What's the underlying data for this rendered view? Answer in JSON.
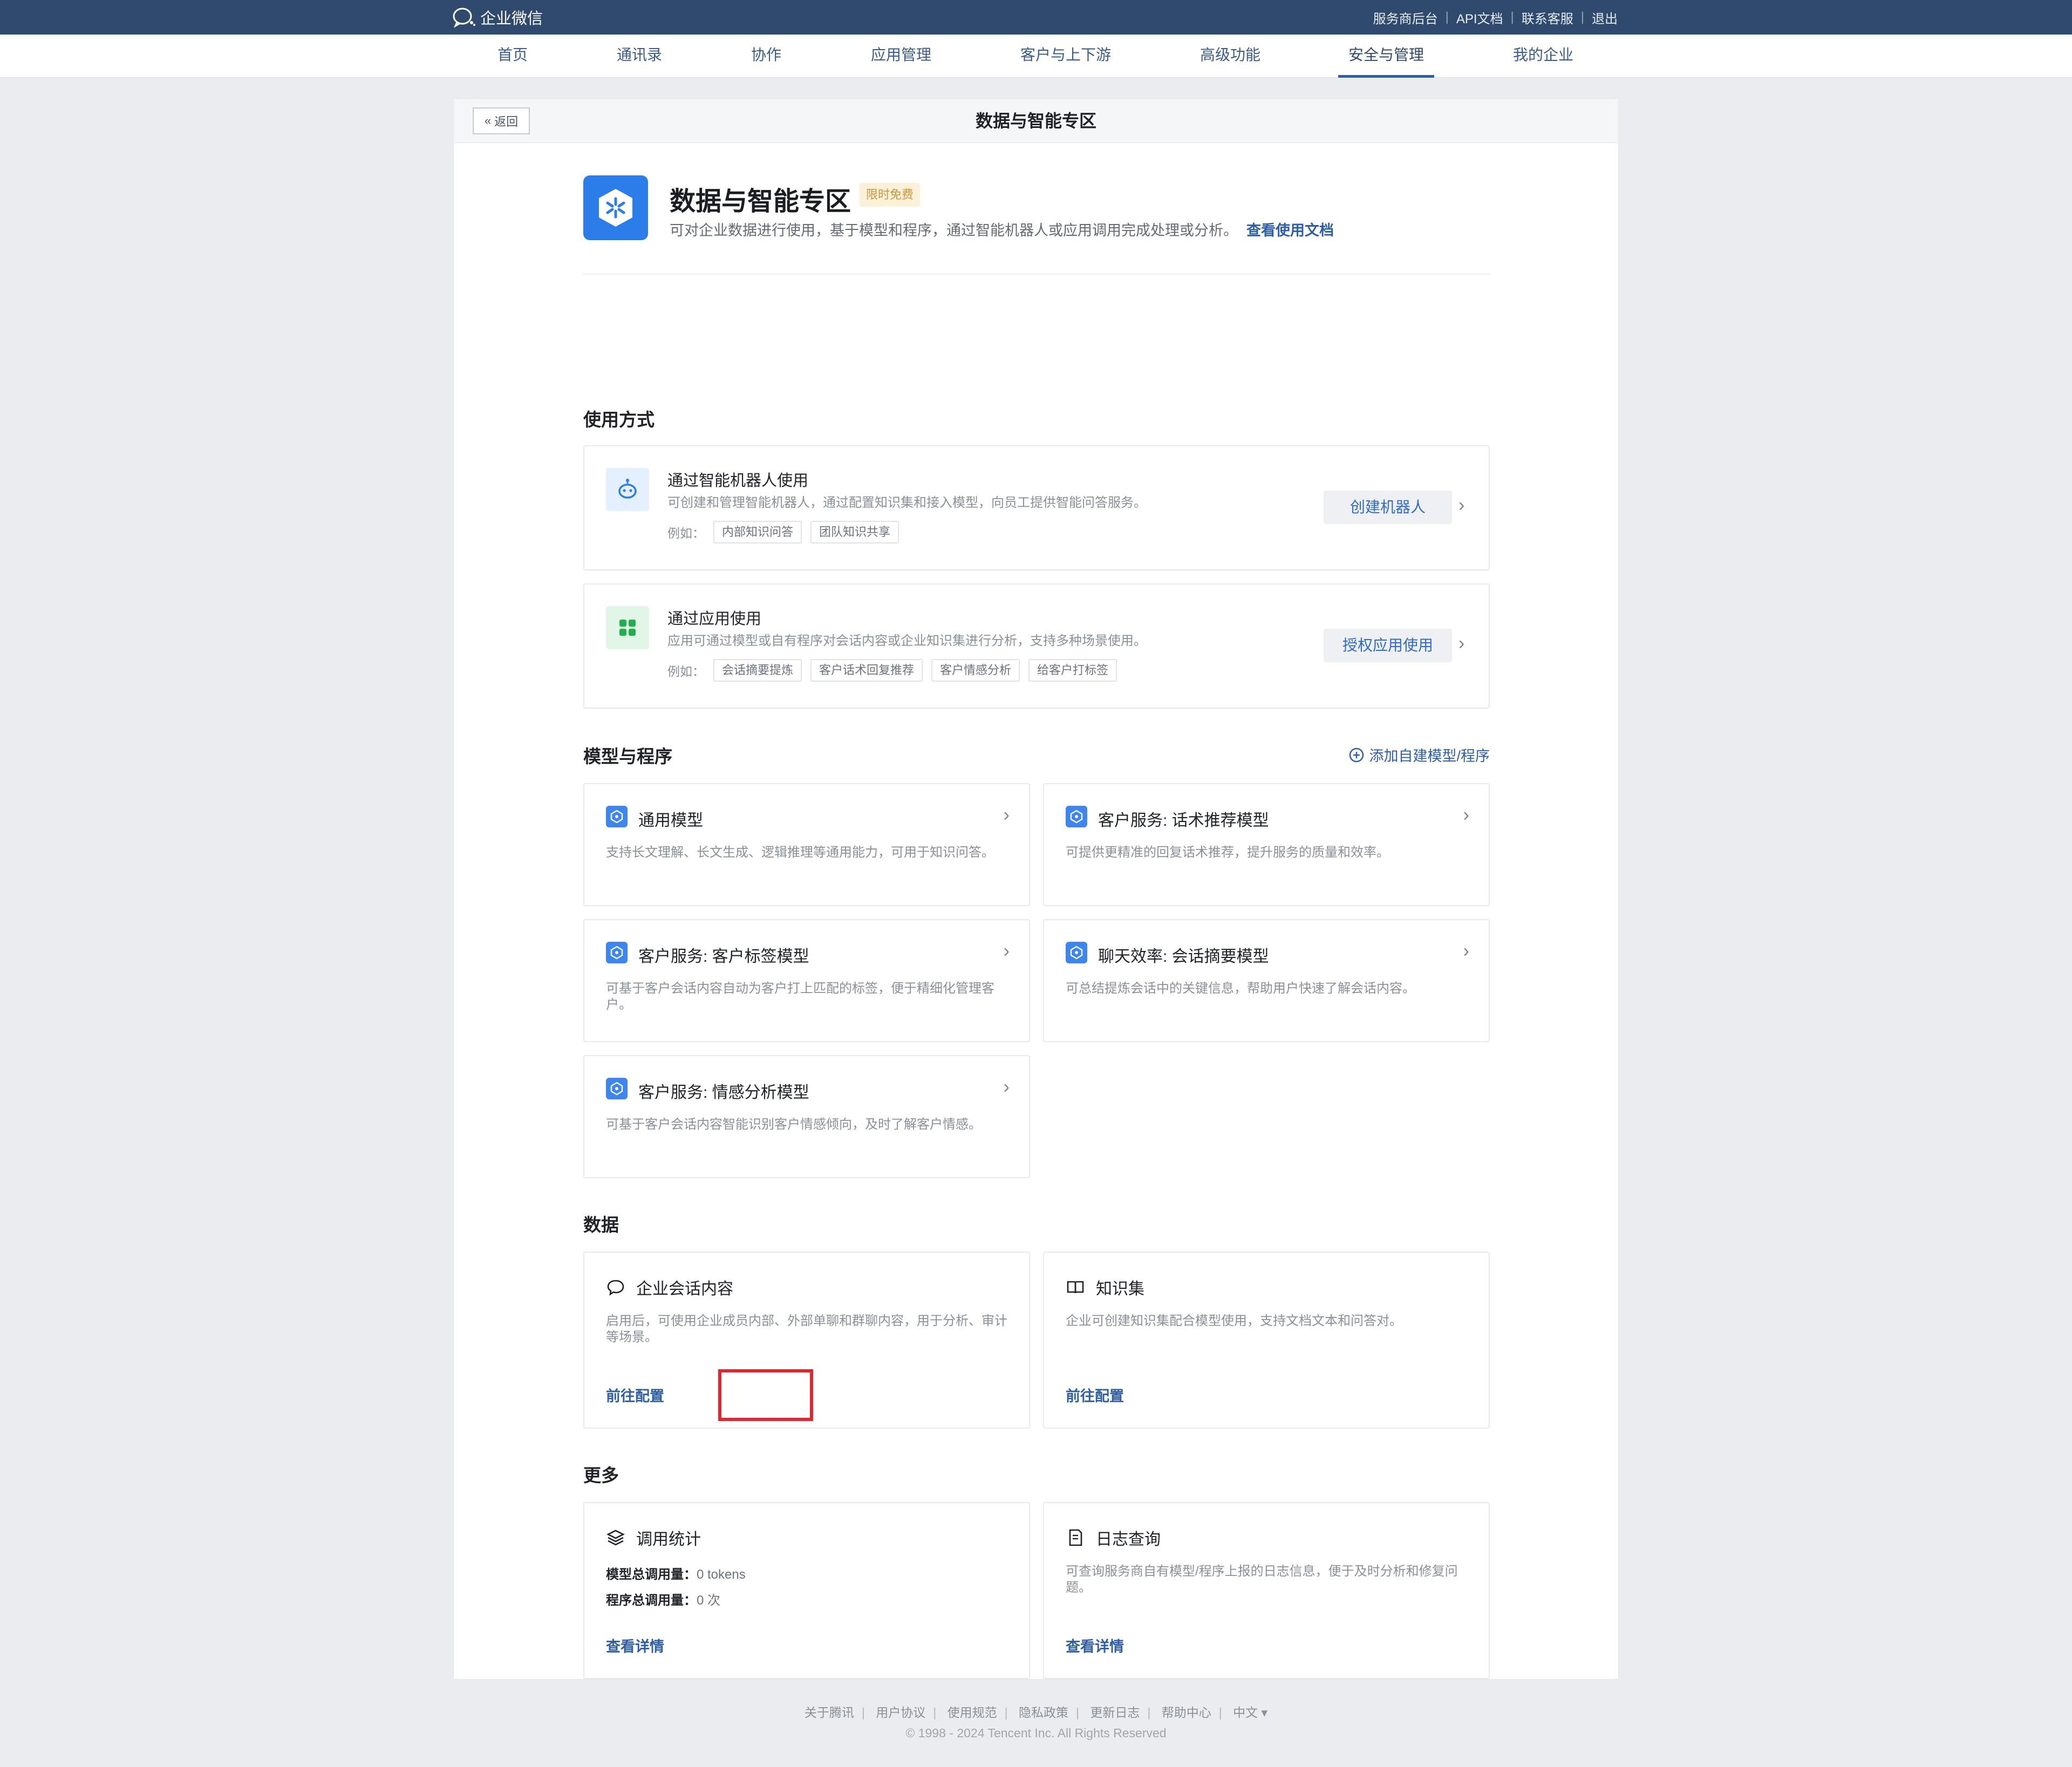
{
  "header": {
    "brand": "企业微信",
    "links": [
      "服务商后台",
      "API文档",
      "联系客服",
      "退出"
    ]
  },
  "nav": {
    "items": [
      "首页",
      "通讯录",
      "协作",
      "应用管理",
      "客户与上下游",
      "高级功能",
      "安全与管理",
      "我的企业"
    ],
    "active": "安全与管理"
  },
  "panel": {
    "back_label": "返回",
    "title": "数据与智能专区"
  },
  "hero": {
    "title": "数据与智能专区",
    "tag": "限时免费",
    "desc": "可对企业数据进行使用，基于模型和程序，通过智能机器人或应用调用完成处理或分析。",
    "doc_link": "查看使用文档"
  },
  "usage": {
    "section_title": "使用方式",
    "example_label": "例如：",
    "cards": [
      {
        "title": "通过智能机器人使用",
        "desc": "可创建和管理智能机器人，通过配置知识集和接入模型，向员工提供智能问答服务。",
        "examples": [
          "内部知识问答",
          "团队知识共享"
        ],
        "button": "创建机器人"
      },
      {
        "title": "通过应用使用",
        "desc": "应用可通过模型或自有程序对会话内容或企业知识集进行分析，支持多种场景使用。",
        "examples": [
          "会话摘要提炼",
          "客户话术回复推荐",
          "客户情感分析",
          "给客户打标签"
        ],
        "button": "授权应用使用"
      }
    ]
  },
  "models": {
    "section_title": "模型与程序",
    "add_label": "添加自建模型/程序",
    "cards": [
      {
        "title": "通用模型",
        "desc": "支持长文理解、长文生成、逻辑推理等通用能力，可用于知识问答。"
      },
      {
        "title": "客户服务: 话术推荐模型",
        "desc": "可提供更精准的回复话术推荐，提升服务的质量和效率。"
      },
      {
        "title": "客户服务: 客户标签模型",
        "desc": "可基于客户会话内容自动为客户打上匹配的标签，便于精细化管理客户。"
      },
      {
        "title": "聊天效率: 会话摘要模型",
        "desc": "可总结提炼会话中的关键信息，帮助用户快速了解会话内容。"
      },
      {
        "title": "客户服务: 情感分析模型",
        "desc": "可基于客户会话内容智能识别客户情感倾向，及时了解客户情感。"
      }
    ]
  },
  "data_section": {
    "section_title": "数据",
    "cards": [
      {
        "title": "企业会话内容",
        "desc": "启用后，可使用企业成员内部、外部单聊和群聊内容，用于分析、审计等场景。",
        "link": "前往配置"
      },
      {
        "title": "知识集",
        "desc": "企业可创建知识集配合模型使用，支持文档文本和问答对。",
        "link": "前往配置"
      }
    ]
  },
  "more": {
    "section_title": "更多",
    "stats": {
      "title": "调用统计",
      "model_label": "模型总调用量：",
      "model_value": "0 tokens",
      "program_label": "程序总调用量：",
      "program_value": "0 次",
      "link": "查看详情"
    },
    "logs": {
      "title": "日志查询",
      "desc": "可查询服务商自有模型/程序上报的日志信息，便于及时分析和修复问题。",
      "link": "查看详情"
    }
  },
  "footer": {
    "links": [
      "关于腾讯",
      "用户协议",
      "使用规范",
      "隐私政策",
      "更新日志",
      "帮助中心",
      "中文 ▾"
    ],
    "copyright": "© 1998 - 2024 Tencent Inc. All Rights Reserved"
  },
  "colors": {
    "topbar": "#2f4a6d",
    "accent": "#2f5ea2",
    "highlight": "#e3262d"
  }
}
